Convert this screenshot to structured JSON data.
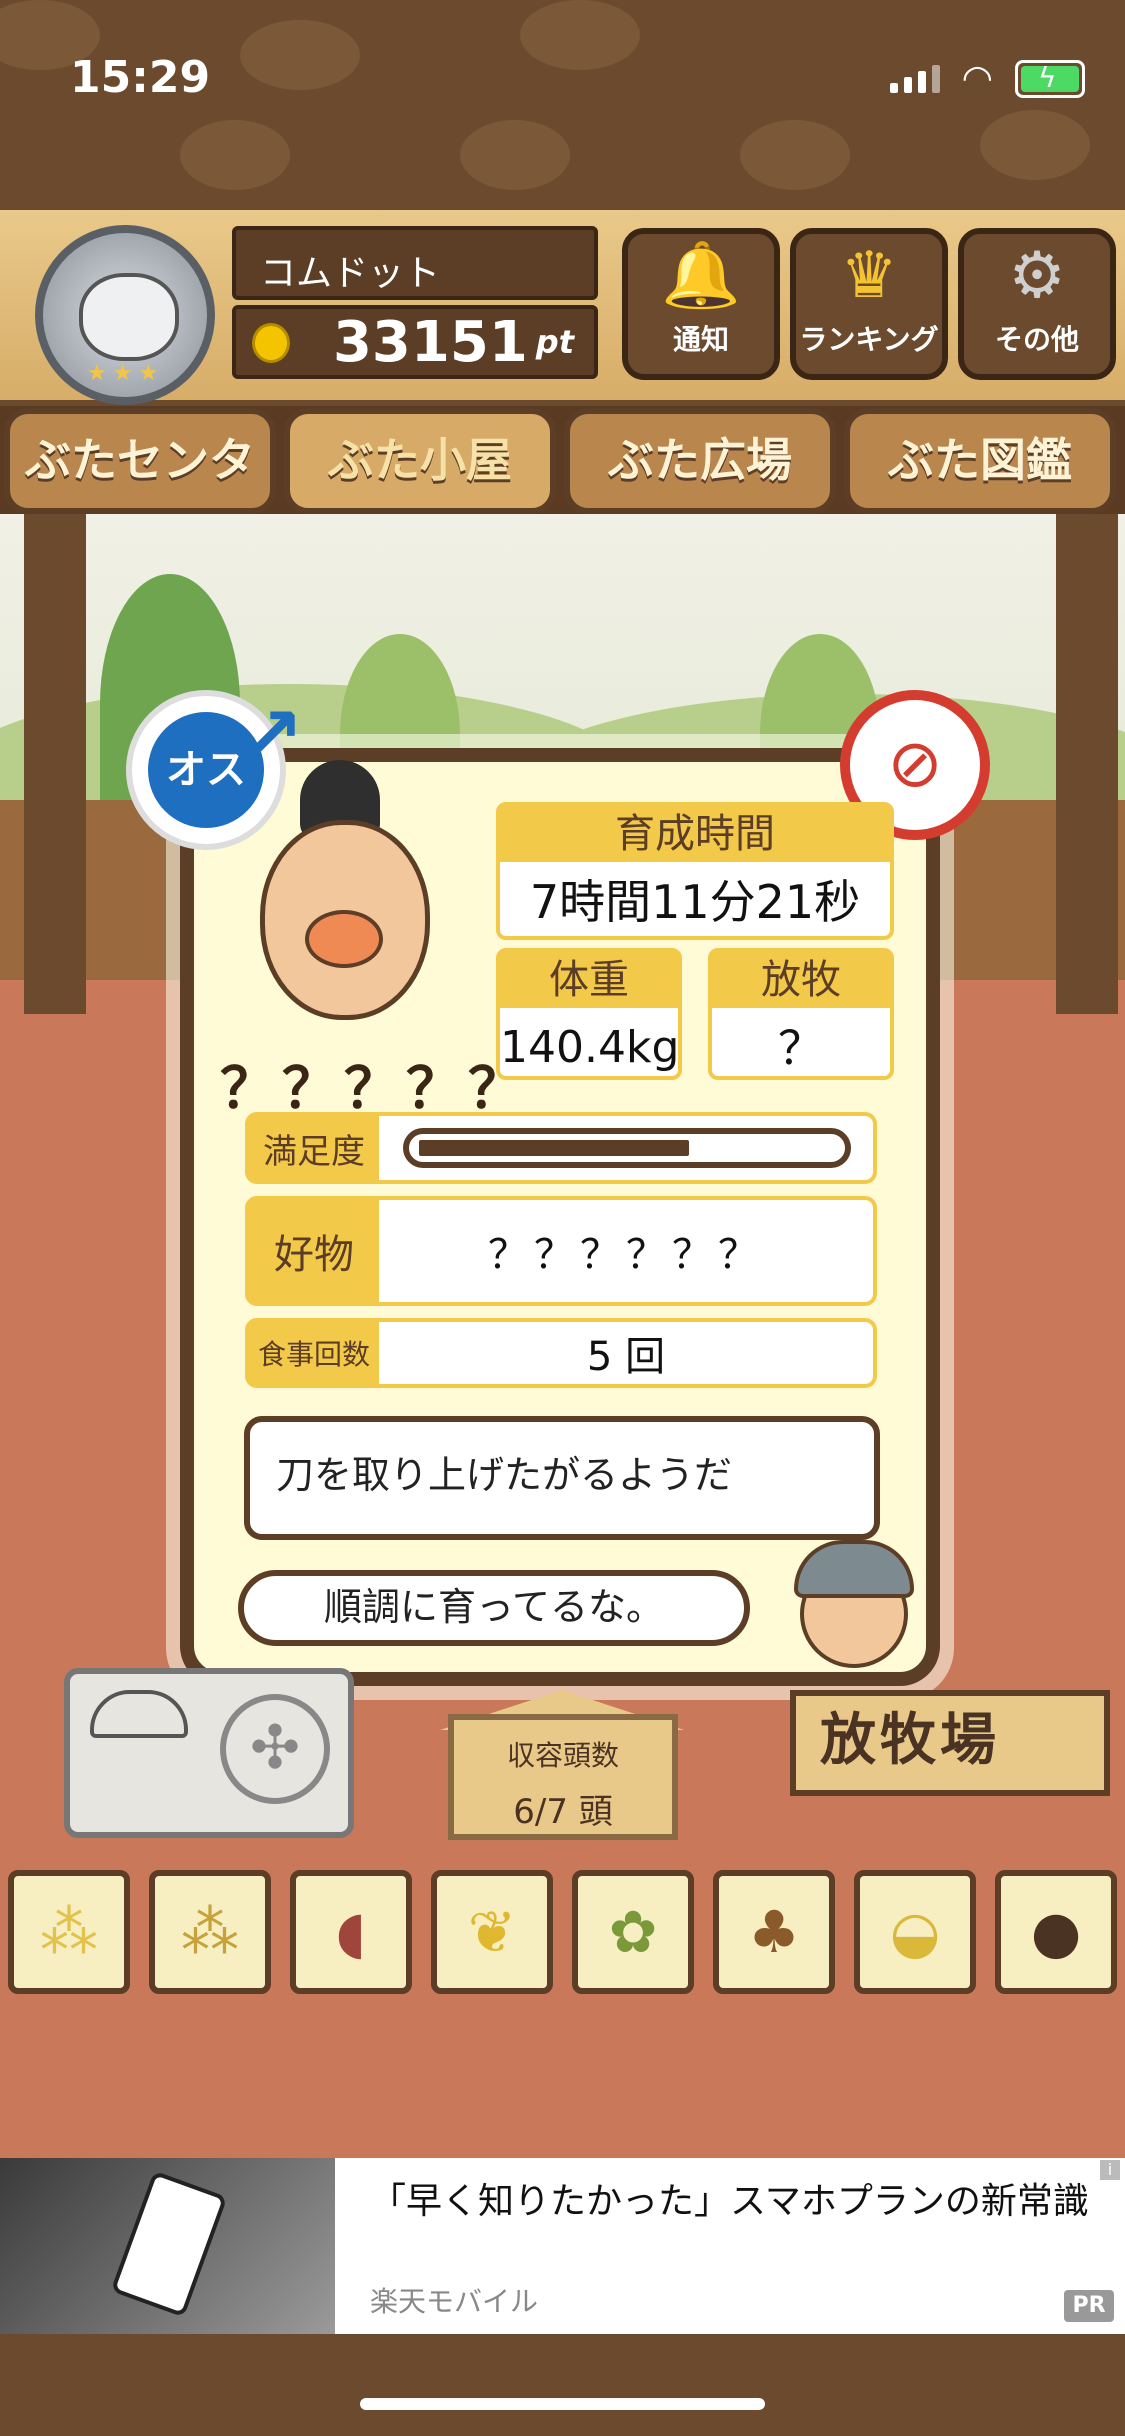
{
  "status": {
    "time": "15:29"
  },
  "header": {
    "username": "コムドット",
    "points": "33151",
    "points_unit": "pt",
    "buttons": [
      {
        "label": "通知",
        "icon": "bell-icon"
      },
      {
        "label": "ランキング",
        "icon": "crown-icon"
      },
      {
        "label": "その他",
        "icon": "gear-icon"
      }
    ]
  },
  "tabs": [
    {
      "label": "ぶたセンター"
    },
    {
      "label": "ぶた小屋"
    },
    {
      "label": "ぶた広場"
    },
    {
      "label": "ぶた図鑑"
    }
  ],
  "pig": {
    "gender_label": "オス",
    "name": "？？？？？",
    "stats": {
      "growth_time_label": "育成時間",
      "growth_time_value": "7時間11分21秒",
      "weight_label": "体重",
      "weight_value": "140.4kg",
      "grazing_label": "放牧",
      "grazing_value": "？"
    },
    "satisfaction_label": "満足度",
    "satisfaction_level": 0.65,
    "favorite_label": "好物",
    "favorite_value": "？？？？？？",
    "meals_label": "食事回数",
    "meals_value": "5 回"
  },
  "dialogue": {
    "comment": "刀を取り上げたがるようだ",
    "farmer_line": "順調に育ってるな。"
  },
  "barn": {
    "capacity_label": "収容頭数",
    "capacity_value": "6/7 頭",
    "pasture_sign": "放牧場"
  },
  "foods": [
    {
      "icon": "grain-pile-icon"
    },
    {
      "icon": "mixed-grain-icon"
    },
    {
      "icon": "sweet-potato-icon"
    },
    {
      "icon": "corn-icon"
    },
    {
      "icon": "berries-icon"
    },
    {
      "icon": "acorn-icon"
    },
    {
      "icon": "soybean-plate-icon"
    },
    {
      "icon": "truffle-plate-icon"
    }
  ],
  "ad": {
    "title": "「早く知りたかった」スマホプランの新常識",
    "source": "楽天モバイル",
    "badge": "PR"
  }
}
